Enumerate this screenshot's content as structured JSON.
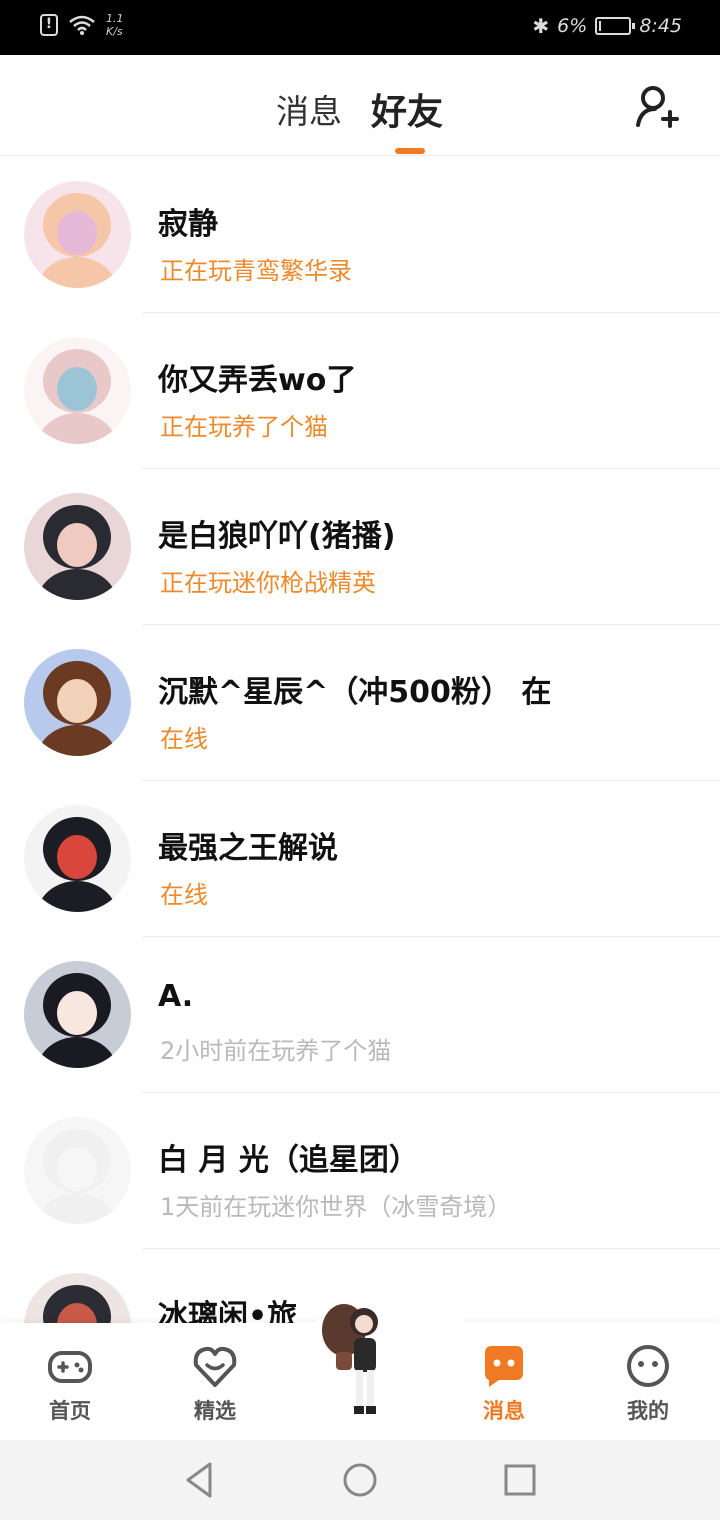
{
  "status_bar": {
    "speed_top": "1.1",
    "speed_bottom": "K/s",
    "battery_percent": "6%",
    "battery_level": 0.06,
    "time": "8:45"
  },
  "header": {
    "tabs": [
      {
        "label": "消息",
        "active": false
      },
      {
        "label": "好友",
        "active": true
      }
    ],
    "add_friend_icon": "add-friend-icon"
  },
  "friends": [
    {
      "name": "寂静",
      "status": "正在玩青鸾繁华录",
      "state": "active",
      "avatar_colors": [
        "#f7e3ea",
        "#f5c7a8",
        "#e6b8d8"
      ]
    },
    {
      "name": "你又弄丢wo了",
      "status": "正在玩养了个猫",
      "state": "active",
      "avatar_colors": [
        "#fbf4f4",
        "#e8c8c8",
        "#9bc4d6"
      ]
    },
    {
      "name": "是白狼吖吖(猪播)",
      "status": "正在玩迷你枪战精英",
      "state": "active",
      "avatar_colors": [
        "#e9d6d6",
        "#2a2a33",
        "#f0c9c0"
      ]
    },
    {
      "name": "沉默^星辰^（冲500粉） 在",
      "status": "在线",
      "state": "active",
      "avatar_colors": [
        "#b8c9ee",
        "#6b3a22",
        "#f2d2b8"
      ]
    },
    {
      "name": "最强之王解说",
      "status": "在线",
      "state": "active",
      "avatar_colors": [
        "#f3f3f3",
        "#1c1c24",
        "#d9463b"
      ]
    },
    {
      "name": "A.",
      "status": "2小时前在玩养了个猫",
      "state": "idle",
      "avatar_colors": [
        "#c8ccd6",
        "#1a1a22",
        "#f7e7df"
      ]
    },
    {
      "name": "白  月  光（追星团）",
      "status": "1天前在玩迷你世界（冰雪奇境）",
      "state": "idle",
      "avatar_colors": [
        "#f6f6f6",
        "#f0f0f0",
        "#f6f6f6"
      ]
    },
    {
      "name": "冰璃闲•旅",
      "status": "",
      "state": "active",
      "avatar_colors": [
        "#efe4e4",
        "#2c2c35",
        "#c95a4a"
      ]
    }
  ],
  "bottom_nav": [
    {
      "label": "首页",
      "icon": "gamepad-icon",
      "active": false
    },
    {
      "label": "精选",
      "icon": "heart-chat-icon",
      "active": false
    },
    {
      "label": "",
      "icon": "mascot-character",
      "active": false
    },
    {
      "label": "消息",
      "icon": "message-bubble-icon",
      "active": true
    },
    {
      "label": "我的",
      "icon": "smiley-face-icon",
      "active": false
    }
  ],
  "colors": {
    "accent": "#f07a23",
    "active_status": "#ec8a2c",
    "idle_status": "#b9b9b9",
    "text": "#111111"
  }
}
